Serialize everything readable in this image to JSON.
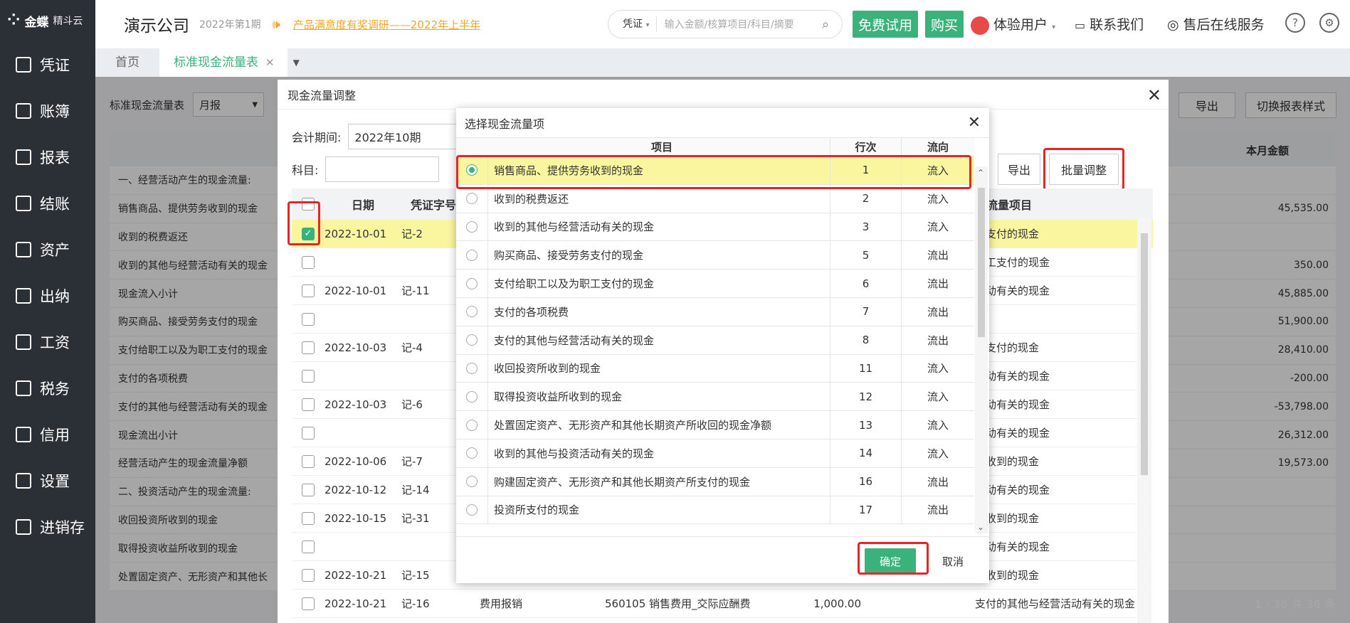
{
  "sidebar": {
    "logo": "金蝶",
    "logo_sub": "精斗云",
    "items": [
      {
        "label": "凭证",
        "icon": "voucher-icon"
      },
      {
        "label": "账簿",
        "icon": "ledger-icon"
      },
      {
        "label": "报表",
        "icon": "report-icon"
      },
      {
        "label": "结账",
        "icon": "close-books-icon"
      },
      {
        "label": "资产",
        "icon": "asset-icon"
      },
      {
        "label": "出纳",
        "icon": "cashier-icon"
      },
      {
        "label": "工资",
        "icon": "salary-icon"
      },
      {
        "label": "税务",
        "icon": "tax-icon"
      },
      {
        "label": "信用",
        "icon": "credit-icon"
      },
      {
        "label": "设置",
        "icon": "settings-icon"
      },
      {
        "label": "进销存",
        "icon": "inventory-icon"
      }
    ]
  },
  "header": {
    "company": "演示公司",
    "period": "2022年第1期",
    "survey": "产品满意度有奖调研——2022年上半年",
    "search_type": "凭证",
    "search_placeholder": "输入金额/核算项目/科目/摘要",
    "free_trial": "免费试用",
    "buy": "购买",
    "user": "体验用户",
    "contact": "联系我们",
    "support": "售后在线服务"
  },
  "tabs": [
    {
      "label": "首页"
    },
    {
      "label": "标准现金流量表"
    }
  ],
  "background": {
    "title": "标准现金流量表",
    "period_type": "月报",
    "export": "导出",
    "switch_style": "切换报表样式",
    "col_amount": "本月金额",
    "rows": [
      {
        "label": "一、经营活动产生的现金流量:",
        "amount": ""
      },
      {
        "label": "销售商品、提供劳务收到的现金",
        "amount": "45,535.00"
      },
      {
        "label": "收到的税费返还",
        "amount": ""
      },
      {
        "label": "收到的其他与经营活动有关的现金",
        "amount": "350.00"
      },
      {
        "label": "现金流入小计",
        "amount": "45,885.00"
      },
      {
        "label": "购买商品、接受劳务支付的现金",
        "amount": "51,900.00"
      },
      {
        "label": "支付给职工以及为职工支付的现金",
        "amount": "28,410.00"
      },
      {
        "label": "支付的各项税费",
        "amount": "-200.00"
      },
      {
        "label": "支付的其他与经营活动有关的现金",
        "amount": "-53,798.00"
      },
      {
        "label": "现金流出小计",
        "amount": "26,312.00"
      },
      {
        "label": "经营活动产生的现金流量净额",
        "amount": "19,573.00"
      },
      {
        "label": "二、投资活动产生的现金流量:",
        "amount": ""
      },
      {
        "label": "收回投资所收到的现金",
        "amount": ""
      },
      {
        "label": "取得投资收益所收到的现金",
        "amount": ""
      },
      {
        "label": "处置固定资产、无形资产和其他长",
        "amount": ""
      }
    ],
    "pagination": "1 - 36   共 36 条"
  },
  "adjust_dialog": {
    "title": "现金流量调整",
    "period_label": "会计期间:",
    "period_value": "2022年10期",
    "subject_label": "科目:",
    "export": "导出",
    "batch_adjust": "批量调整",
    "col_date": "日期",
    "col_voucher": "凭证字号",
    "col_item": "金流量项目",
    "rows": [
      {
        "date": "2022-10-01",
        "voucher": "记-2",
        "item": "务支付的现金",
        "checked": true
      },
      {
        "date": "",
        "voucher": "",
        "item": "职工支付的现金",
        "checked": false
      },
      {
        "date": "2022-10-01",
        "voucher": "记-11",
        "item": "活动有关的现金",
        "checked": false
      },
      {
        "date": "",
        "voucher": "",
        "item": "",
        "checked": false
      },
      {
        "date": "2022-10-03",
        "voucher": "记-4",
        "item": "务支付的现金",
        "checked": false
      },
      {
        "date": "",
        "voucher": "",
        "item": "活动有关的现金",
        "checked": false
      },
      {
        "date": "2022-10-03",
        "voucher": "记-6",
        "item": "活动有关的现金",
        "checked": false
      },
      {
        "date": "",
        "voucher": "",
        "item": "活动有关的现金",
        "checked": false
      },
      {
        "date": "2022-10-06",
        "voucher": "记-7",
        "item": "务收到的现金",
        "checked": false
      },
      {
        "date": "2022-10-12",
        "voucher": "记-14",
        "item": "活动有关的现金",
        "checked": false
      },
      {
        "date": "2022-10-15",
        "voucher": "记-31",
        "item": "务收到的现金",
        "checked": false
      },
      {
        "date": "",
        "voucher": "",
        "item": "活动有关的现金",
        "checked": false
      },
      {
        "date": "2022-10-21",
        "voucher": "记-15",
        "item": "务收到的现金",
        "checked": false
      },
      {
        "date": "2022-10-21",
        "voucher": "记-16",
        "item": "支付的其他与经营活动有关的现金",
        "checked": false,
        "summary": "费用报销",
        "subject": "560105 销售费用_交际应酬费",
        "amount": "1,000.00"
      }
    ]
  },
  "select_dialog": {
    "title": "选择现金流量项",
    "col_item": "项目",
    "col_line": "行次",
    "col_dir": "流向",
    "ok": "确定",
    "cancel": "取消",
    "rows": [
      {
        "item": "销售商品、提供劳务收到的现金",
        "line": "1",
        "dir": "流入",
        "selected": true
      },
      {
        "item": "收到的税费返还",
        "line": "2",
        "dir": "流入"
      },
      {
        "item": "收到的其他与经营活动有关的现金",
        "line": "3",
        "dir": "流入"
      },
      {
        "item": "购买商品、接受劳务支付的现金",
        "line": "5",
        "dir": "流出"
      },
      {
        "item": "支付给职工以及为职工支付的现金",
        "line": "6",
        "dir": "流出"
      },
      {
        "item": "支付的各项税费",
        "line": "7",
        "dir": "流出"
      },
      {
        "item": "支付的其他与经营活动有关的现金",
        "line": "8",
        "dir": "流出"
      },
      {
        "item": "收回投资所收到的现金",
        "line": "11",
        "dir": "流入"
      },
      {
        "item": "取得投资收益所收到的现金",
        "line": "12",
        "dir": "流入"
      },
      {
        "item": "处置固定资产、无形资产和其他长期资产所收回的现金净额",
        "line": "13",
        "dir": "流入"
      },
      {
        "item": "收到的其他与投资活动有关的现金",
        "line": "14",
        "dir": "流入"
      },
      {
        "item": "购建固定资产、无形资产和其他长期资产所支付的现金",
        "line": "16",
        "dir": "流出"
      },
      {
        "item": "投资所支付的现金",
        "line": "17",
        "dir": "流出"
      }
    ]
  },
  "colors": {
    "accent": "#3bb17b",
    "highlight": "#faf6a0",
    "survey": "#f5a623",
    "annotation": "#e82424"
  }
}
